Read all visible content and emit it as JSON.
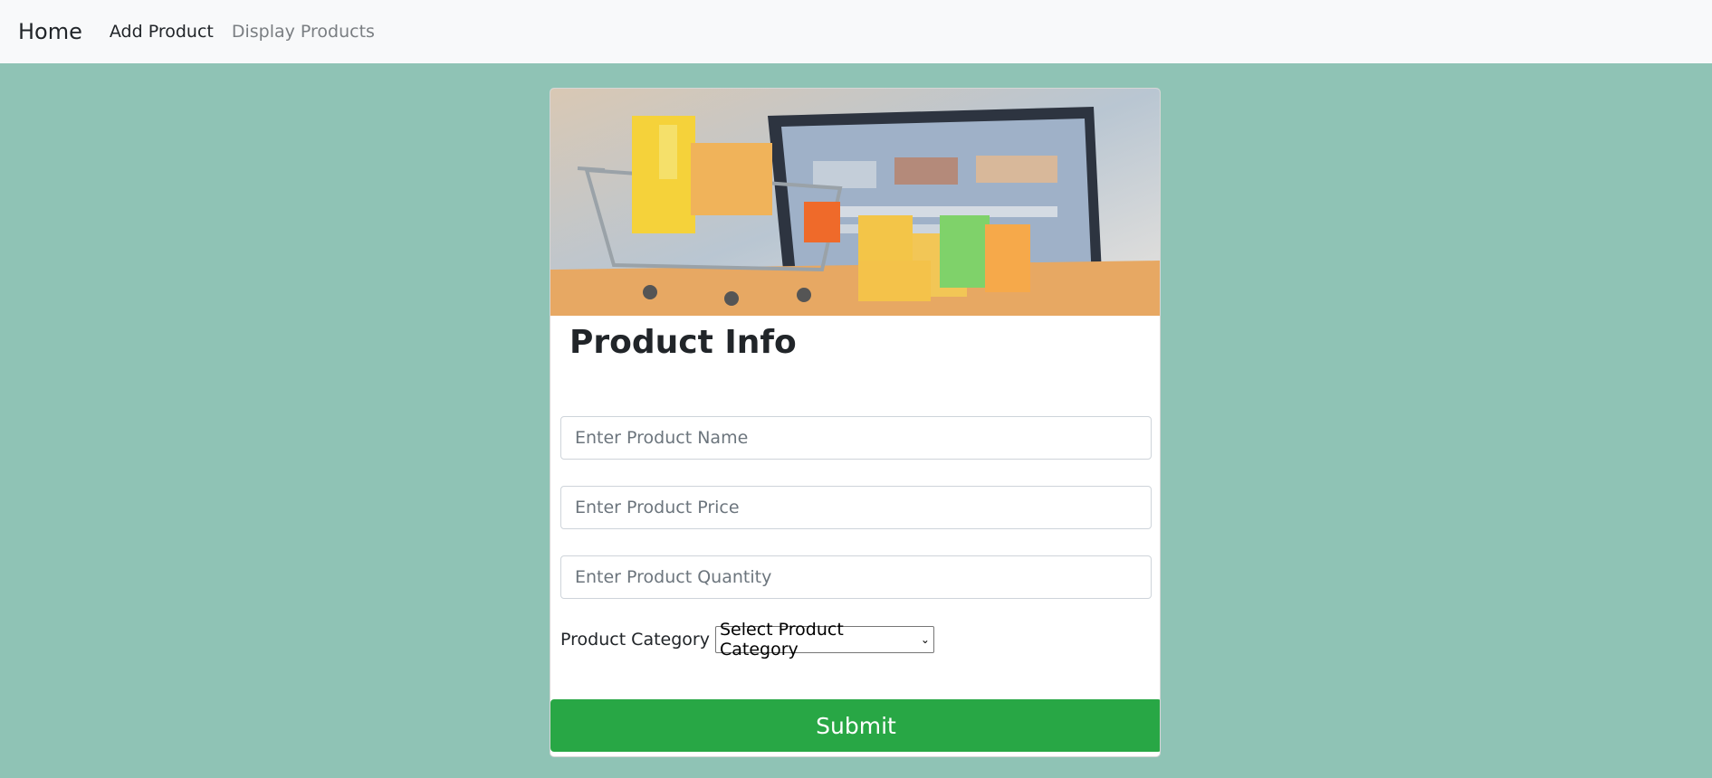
{
  "navbar": {
    "brand": "Home",
    "links": [
      {
        "label": "Add Product",
        "active": true
      },
      {
        "label": "Display Products",
        "active": false
      }
    ]
  },
  "card": {
    "image_description_icon": "shopping-cart-laptop-image",
    "title": "Product Info",
    "fields": {
      "name_placeholder": "Enter Product Name",
      "price_placeholder": "Enter Product Price",
      "quantity_placeholder": "Enter Product Quantity"
    },
    "category": {
      "label": "Product Category",
      "selected": "Select Product Category"
    },
    "submit_label": "Submit"
  },
  "colors": {
    "background": "#8fc3b5",
    "navbar": "#f8f9fa",
    "submit": "#28a745"
  }
}
